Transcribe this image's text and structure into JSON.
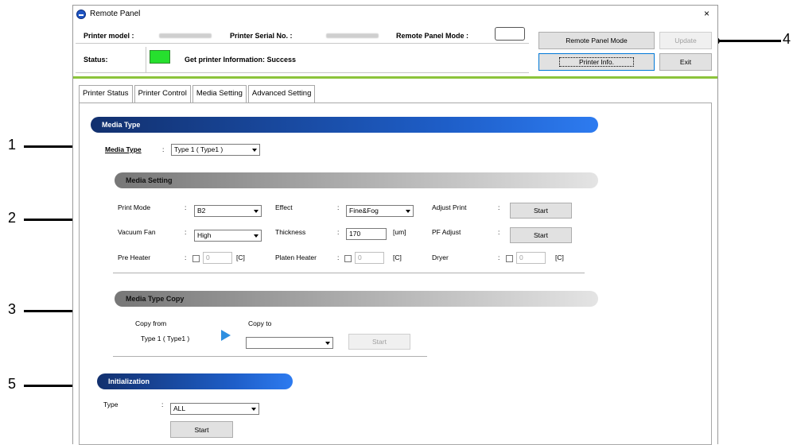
{
  "window": {
    "title": "Remote Panel",
    "close": "×"
  },
  "info": {
    "printer_model_label": "Printer model :",
    "serial_label": "Printer Serial No. :",
    "remote_mode_label": "Remote Panel Mode :",
    "status_label": "Status:",
    "status_message": "Get printer Information: Success",
    "status_color": "#26e02e"
  },
  "buttons": {
    "remote_panel_mode": "Remote Panel Mode",
    "update": "Update",
    "printer_info": "Printer Info.",
    "exit": "Exit"
  },
  "tabs": [
    "Printer Status",
    "Printer Control",
    "Media Setting",
    "Advanced Setting"
  ],
  "media_type": {
    "header": "Media Type",
    "label": "Media Type",
    "colon": ":",
    "value": "Type 1 ( Type1 )"
  },
  "media_setting": {
    "header": "Media Setting",
    "print_mode_label": "Print Mode",
    "print_mode_value": "B2",
    "effect_label": "Effect",
    "effect_value": "Fine&Fog",
    "adjust_print_label": "Adjust Print",
    "adjust_print_button": "Start",
    "vacuum_fan_label": "Vacuum Fan",
    "vacuum_fan_value": "High",
    "thickness_label": "Thickness",
    "thickness_value": "170",
    "thickness_unit": "[um]",
    "pf_adjust_label": "PF Adjust",
    "pf_adjust_button": "Start",
    "pre_heater_label": "Pre Heater",
    "pre_heater_value": "0",
    "platen_heater_label": "Platen Heater",
    "platen_heater_value": "0",
    "dryer_label": "Dryer",
    "dryer_value": "0",
    "temp_unit": "[C]",
    "colon": ":"
  },
  "media_type_copy": {
    "header": "Media Type Copy",
    "copy_from_label": "Copy from",
    "copy_from_value": "Type 1 ( Type1 )",
    "copy_to_label": "Copy to",
    "copy_to_value": "",
    "start_button": "Start"
  },
  "initialization": {
    "header": "Initialization",
    "type_label": "Type",
    "colon": ":",
    "type_value": "ALL",
    "start_button": "Start"
  },
  "callouts": [
    "1",
    "2",
    "3",
    "4",
    "5"
  ]
}
